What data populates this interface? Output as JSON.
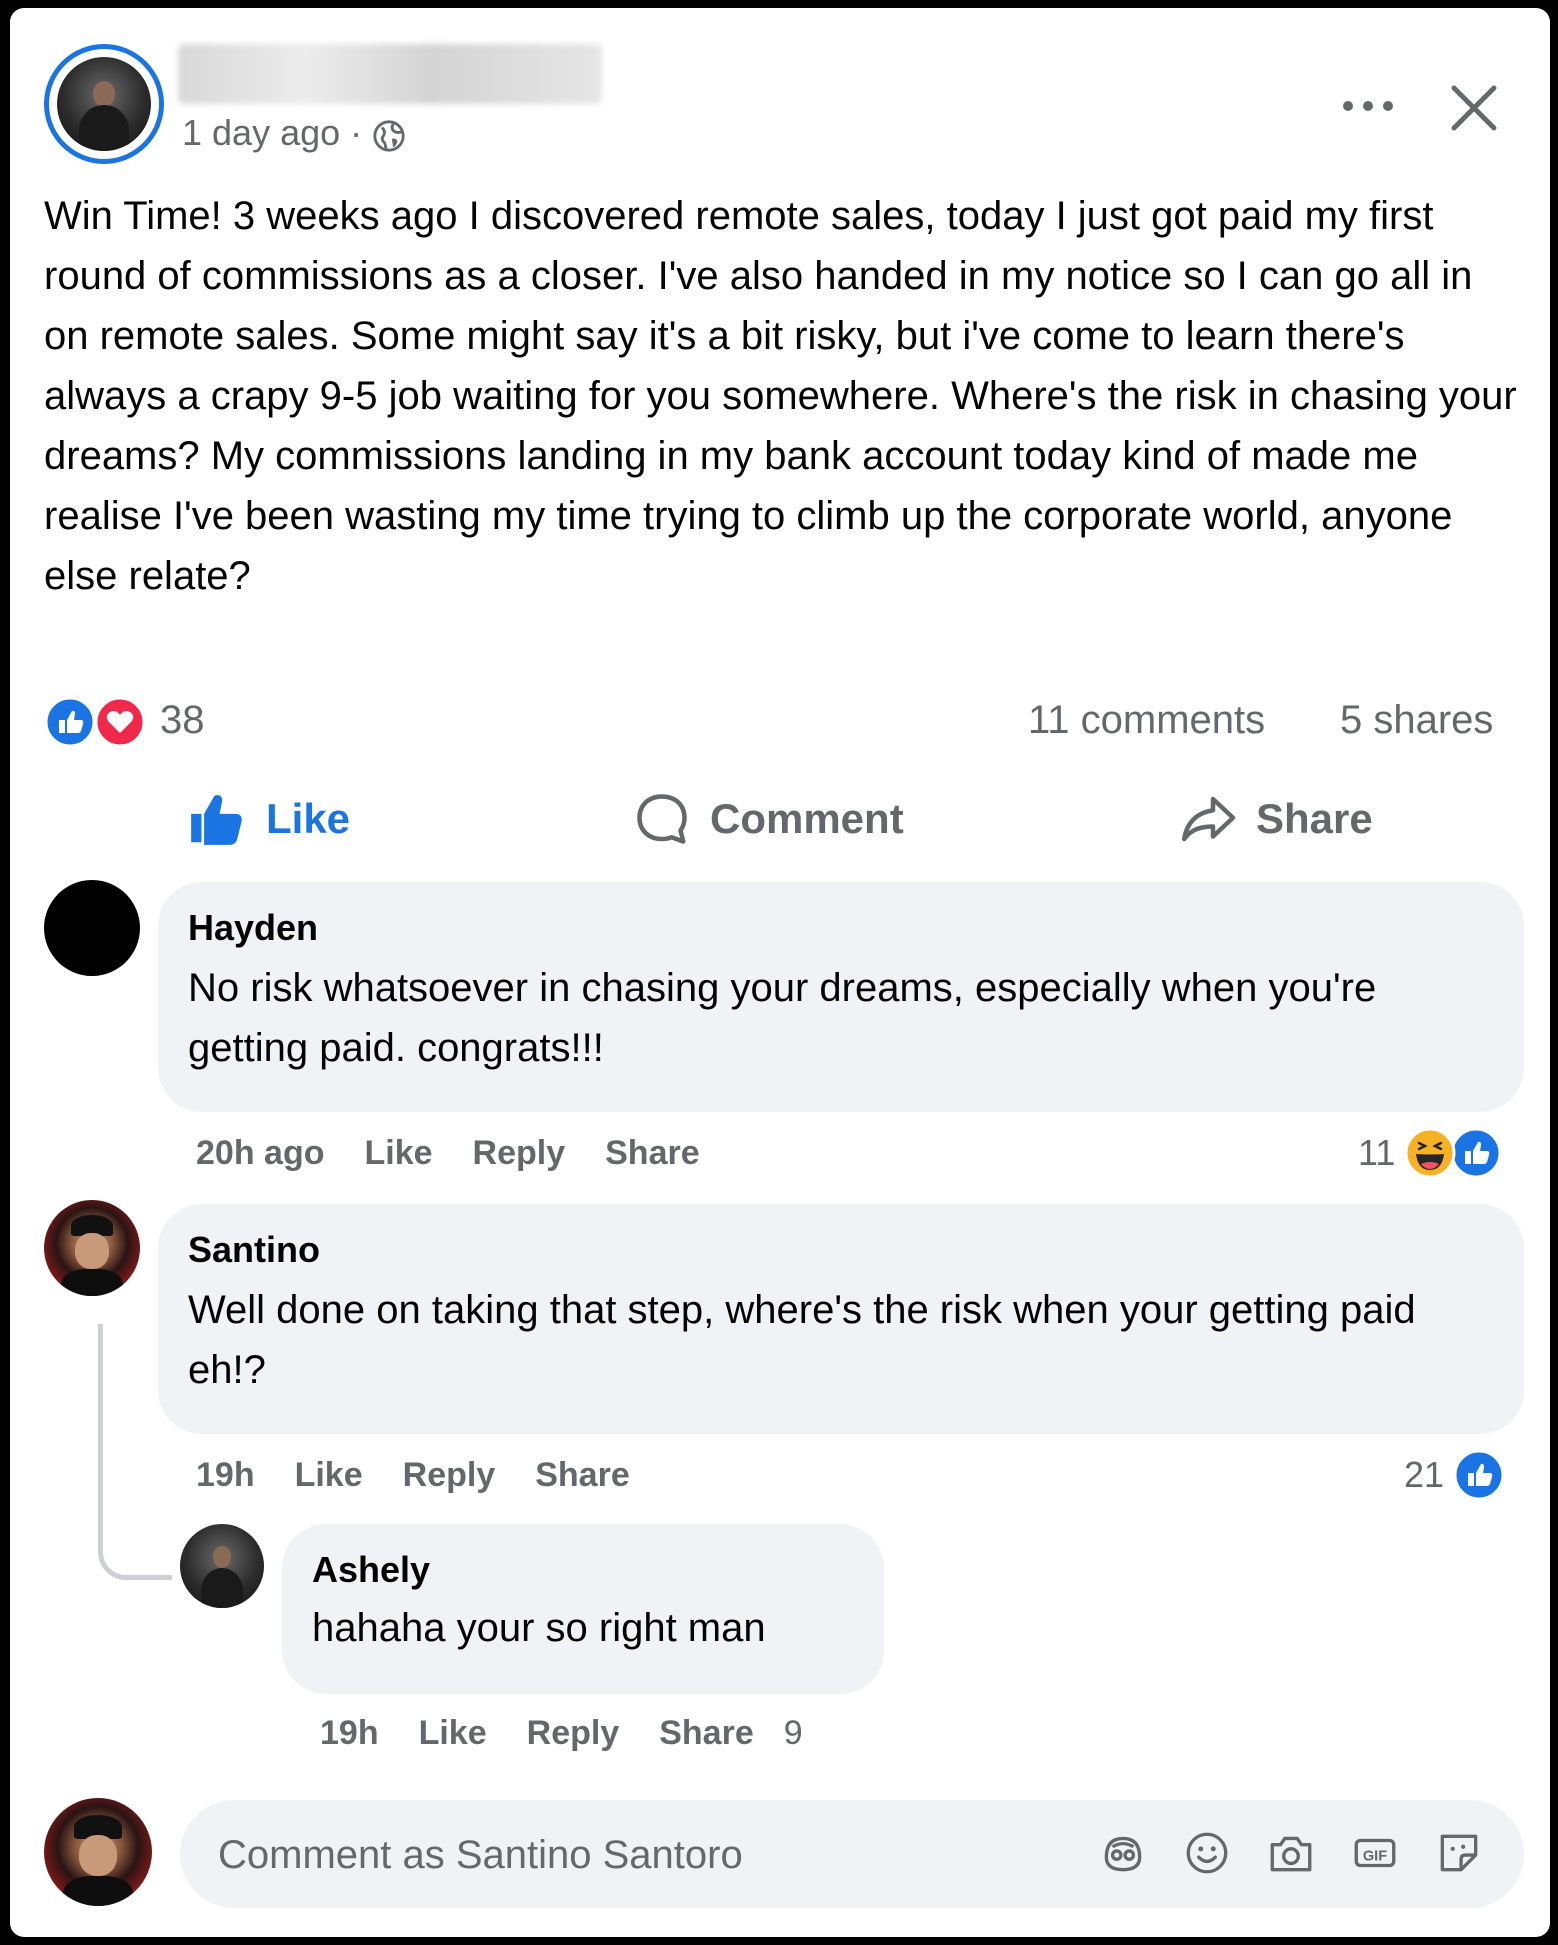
{
  "post": {
    "time": "1 day ago",
    "separator": "·",
    "text": "Win Time! 3 weeks ago I discovered remote sales, today I just got paid my first round of commissions as a closer. I've also handed in my notice so I can go all in on remote sales. Some might say it's a bit risky, but i've come to learn there's always a crapy 9-5 job waiting for you somewhere. Where's the risk in chasing your dreams? My commissions landing in my bank account today kind of made me realise I've been wasting my time trying to climb up the corporate world, anyone else relate?",
    "reaction_count": "38",
    "comments_count": "11 comments",
    "shares_count": "5 shares"
  },
  "actions": {
    "like": "Like",
    "comment": "Comment",
    "share": "Share"
  },
  "comments": [
    {
      "author": "Hayden",
      "text": "No risk whatsoever in chasing your dreams, especially when you're getting paid. congrats!!!",
      "time": "20h ago",
      "like": "Like",
      "reply": "Reply",
      "share": "Share",
      "reaction_count": "11"
    },
    {
      "author": "Santino",
      "text": "Well done on taking that step, where's the risk when your getting paid eh!?",
      "time": "19h",
      "like": "Like",
      "reply": "Reply",
      "share": "Share",
      "reaction_count": "21"
    },
    {
      "author": "Ashely",
      "text": "hahaha your so right man",
      "time": "19h",
      "like": "Like",
      "reply": "Reply",
      "share": "Share",
      "reaction_count": "9"
    }
  ],
  "composer": {
    "placeholder": "Comment as Santino Santoro"
  },
  "colors": {
    "accent": "#1b74e4",
    "love": "#f0284a",
    "secondary_text": "#65676b",
    "bubble": "#f0f2f5"
  },
  "icons": [
    "globe-icon",
    "more-icon",
    "close-icon",
    "like-icon",
    "love-icon",
    "haha-icon",
    "comment-icon",
    "share-icon",
    "avatar-frame-icon",
    "emoji-icon",
    "camera-icon",
    "gif-icon",
    "sticker-icon"
  ]
}
